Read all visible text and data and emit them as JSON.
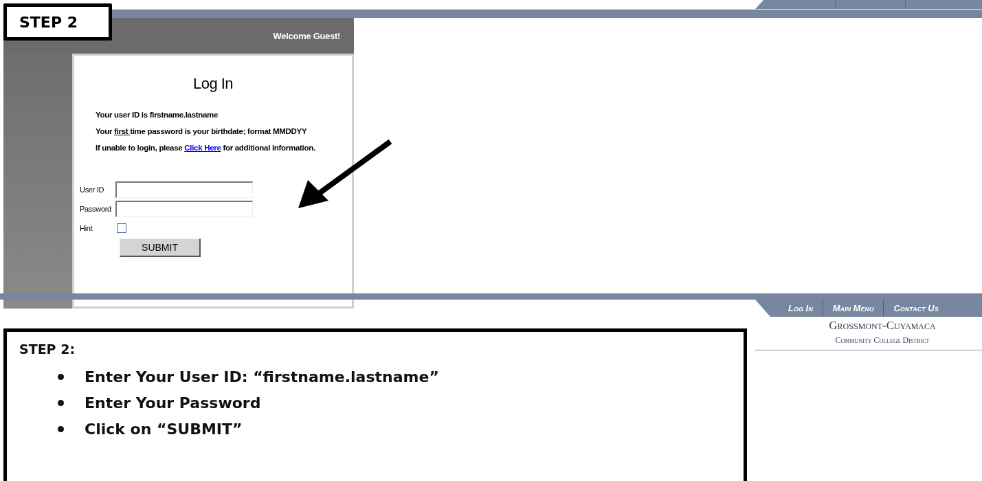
{
  "step_label": "STEP 2",
  "header": {
    "greeting": "Welcome Guest!"
  },
  "login": {
    "title": "Log In",
    "instructions": [
      [
        {
          "kind": "plain",
          "text": "Your user ID is firstname.lastname"
        }
      ],
      [
        {
          "kind": "plain",
          "text": "Your "
        },
        {
          "kind": "underline",
          "text": "first "
        },
        {
          "kind": "plain",
          "text": "time password is your birthdate; format MMDDYY"
        }
      ],
      [
        {
          "kind": "plain",
          "text": "If unable to login, please "
        },
        {
          "kind": "link",
          "text": "Click Here"
        },
        {
          "kind": "plain",
          "text": " for additional information."
        }
      ]
    ],
    "fields": [
      {
        "kind": "text",
        "label": "User ID"
      },
      {
        "kind": "text",
        "label": "Password"
      },
      {
        "kind": "checkbox",
        "label": "Hint",
        "checked": false
      }
    ],
    "submit": "SUBMIT"
  },
  "footer_nav": [
    "Log In",
    "Main Menu",
    "Contact Us"
  ],
  "logo": {
    "name": "Grossmont-Cuyamaca",
    "subtitle": "Community College District"
  },
  "callout": {
    "title": "STEP 2:",
    "bullets": [
      "Enter Your User ID:  “firstname.lastname”",
      "Enter Your Password",
      "Click on “SUBMIT”"
    ]
  }
}
